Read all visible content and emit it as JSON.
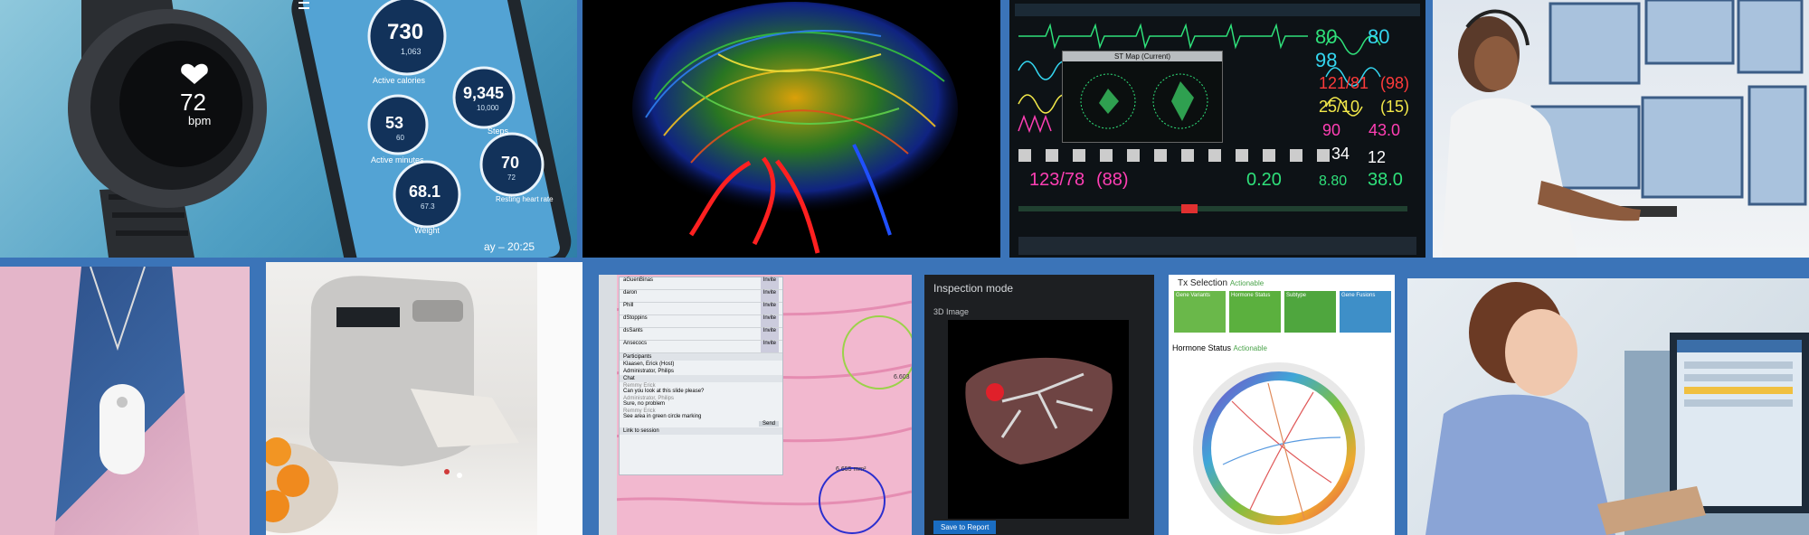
{
  "watch": {
    "value": "72",
    "unit": "bpm"
  },
  "phone": {
    "metrics": [
      {
        "value": "730",
        "sub": "1,063",
        "label": "Active calories"
      },
      {
        "value": "53",
        "sub": "60",
        "label": "Active minutes"
      },
      {
        "value": "9,345",
        "sub": "10,000",
        "label": "Steps"
      },
      {
        "value": "68.1",
        "sub": "67.3",
        "label": "Weight"
      },
      {
        "value": "70",
        "sub": "72",
        "label": "Resting heart rate"
      }
    ],
    "footer": "ay – 20:25"
  },
  "monitor": {
    "popup_title": "ST Map (Current)",
    "values": [
      "80",
      "98",
      "121/81",
      "(98)",
      "25/10",
      "(15)",
      "90",
      "43.0",
      "34",
      "12"
    ],
    "left_values": [
      "80",
      "98"
    ],
    "bp": "123/78",
    "bp_mean": "(88)",
    "v1": "0.20",
    "v2": "8.80",
    "v3": "38.0"
  },
  "pathology": {
    "participants": [
      "aGuenBinas",
      "daron",
      "Phill",
      "dStoppins",
      "dsSants",
      "Ansecocs"
    ],
    "chip": "Invite",
    "participants_label": "Participants",
    "chat_label": "Chat",
    "roles": [
      "Klaasen, Erick (Host)",
      "Administrator, Philips"
    ],
    "messages": [
      {
        "from": "Remmy Erick",
        "text": "Can you look at this slide please?"
      },
      {
        "from": "Administrator, Philips",
        "text": "Sure, no problem"
      },
      {
        "from": "Remmy Erick",
        "text": "See area in green circle marking"
      }
    ],
    "send": "Send",
    "link": "Link to session",
    "measure1": "6.603",
    "measure2": "6.655 mm²"
  },
  "inspection": {
    "title": "Inspection mode",
    "subtitle": "3D Image",
    "button": "Save to Report"
  },
  "tx": {
    "title": "Tx Selection",
    "actionable": "Actionable",
    "cards": [
      "Gene Variants",
      "Hormone Status",
      "Subtype",
      "Gene Fusions"
    ],
    "section": "Hormone Status",
    "section_tag": "Actionable"
  },
  "colors": {
    "brand_blue": "#3b74b8",
    "monitor_green": "#2fe07a",
    "monitor_cyan": "#34d6f0",
    "monitor_yellow": "#f2e84a",
    "monitor_pink": "#ff3fb4",
    "monitor_red": "#ff3b3b"
  }
}
